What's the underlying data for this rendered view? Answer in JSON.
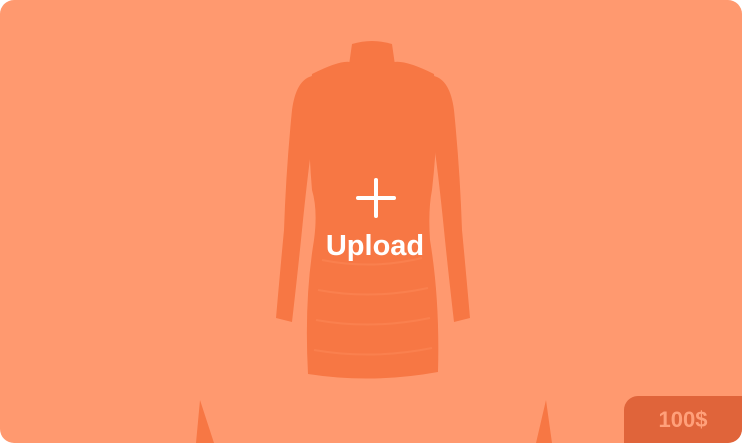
{
  "card": {
    "upload_label": "Upload",
    "price_label": "100$",
    "image_subject": "dress",
    "icon": "plus-icon"
  },
  "colors": {
    "overlay": "#FF8A5B",
    "dress": "#E06A3E",
    "badge_bg": "#E0643A",
    "badge_text": "#FFA07A",
    "upload_text": "#FFFFFF"
  }
}
